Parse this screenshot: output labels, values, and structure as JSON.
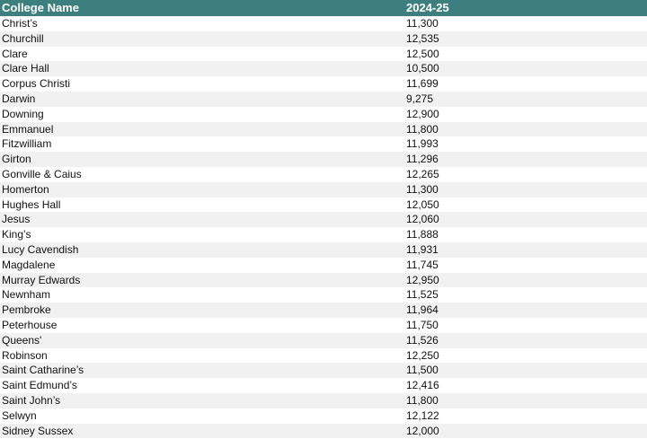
{
  "table": {
    "headers": [
      "College Name",
      "2024-25"
    ],
    "rows": [
      [
        "Christ’s",
        "11,300"
      ],
      [
        "Churchill",
        "12,535"
      ],
      [
        "Clare",
        "12,500"
      ],
      [
        "Clare Hall",
        "10,500"
      ],
      [
        "Corpus Christi",
        "11,699"
      ],
      [
        "Darwin",
        "9,275"
      ],
      [
        "Downing",
        "12,900"
      ],
      [
        "Emmanuel",
        "11,800"
      ],
      [
        "Fitzwilliam",
        "11,993"
      ],
      [
        "Girton",
        "11,296"
      ],
      [
        "Gonville & Caius",
        "12,265"
      ],
      [
        "Homerton",
        "11,300"
      ],
      [
        "Hughes Hall",
        "12,050"
      ],
      [
        "Jesus",
        "12,060"
      ],
      [
        "King’s",
        "11,888"
      ],
      [
        "Lucy Cavendish",
        "11,931"
      ],
      [
        "Magdalene",
        "11,745"
      ],
      [
        "Murray Edwards",
        "12,950"
      ],
      [
        "Newnham",
        "11,525"
      ],
      [
        "Pembroke",
        "11,964"
      ],
      [
        "Peterhouse",
        "11,750"
      ],
      [
        "Queens'",
        "11,526"
      ],
      [
        "Robinson",
        "12,250"
      ],
      [
        "Saint Catharine’s",
        "11,500"
      ],
      [
        "Saint Edmund’s",
        "12,416"
      ],
      [
        "Saint John’s",
        "11,800"
      ],
      [
        "Selwyn",
        "12,122"
      ],
      [
        "Sidney Sussex",
        "12,000"
      ]
    ]
  },
  "colors": {
    "header_bg": "#3d7f7e",
    "header_text": "#ffffff",
    "stripe": "#f1f1f1"
  }
}
